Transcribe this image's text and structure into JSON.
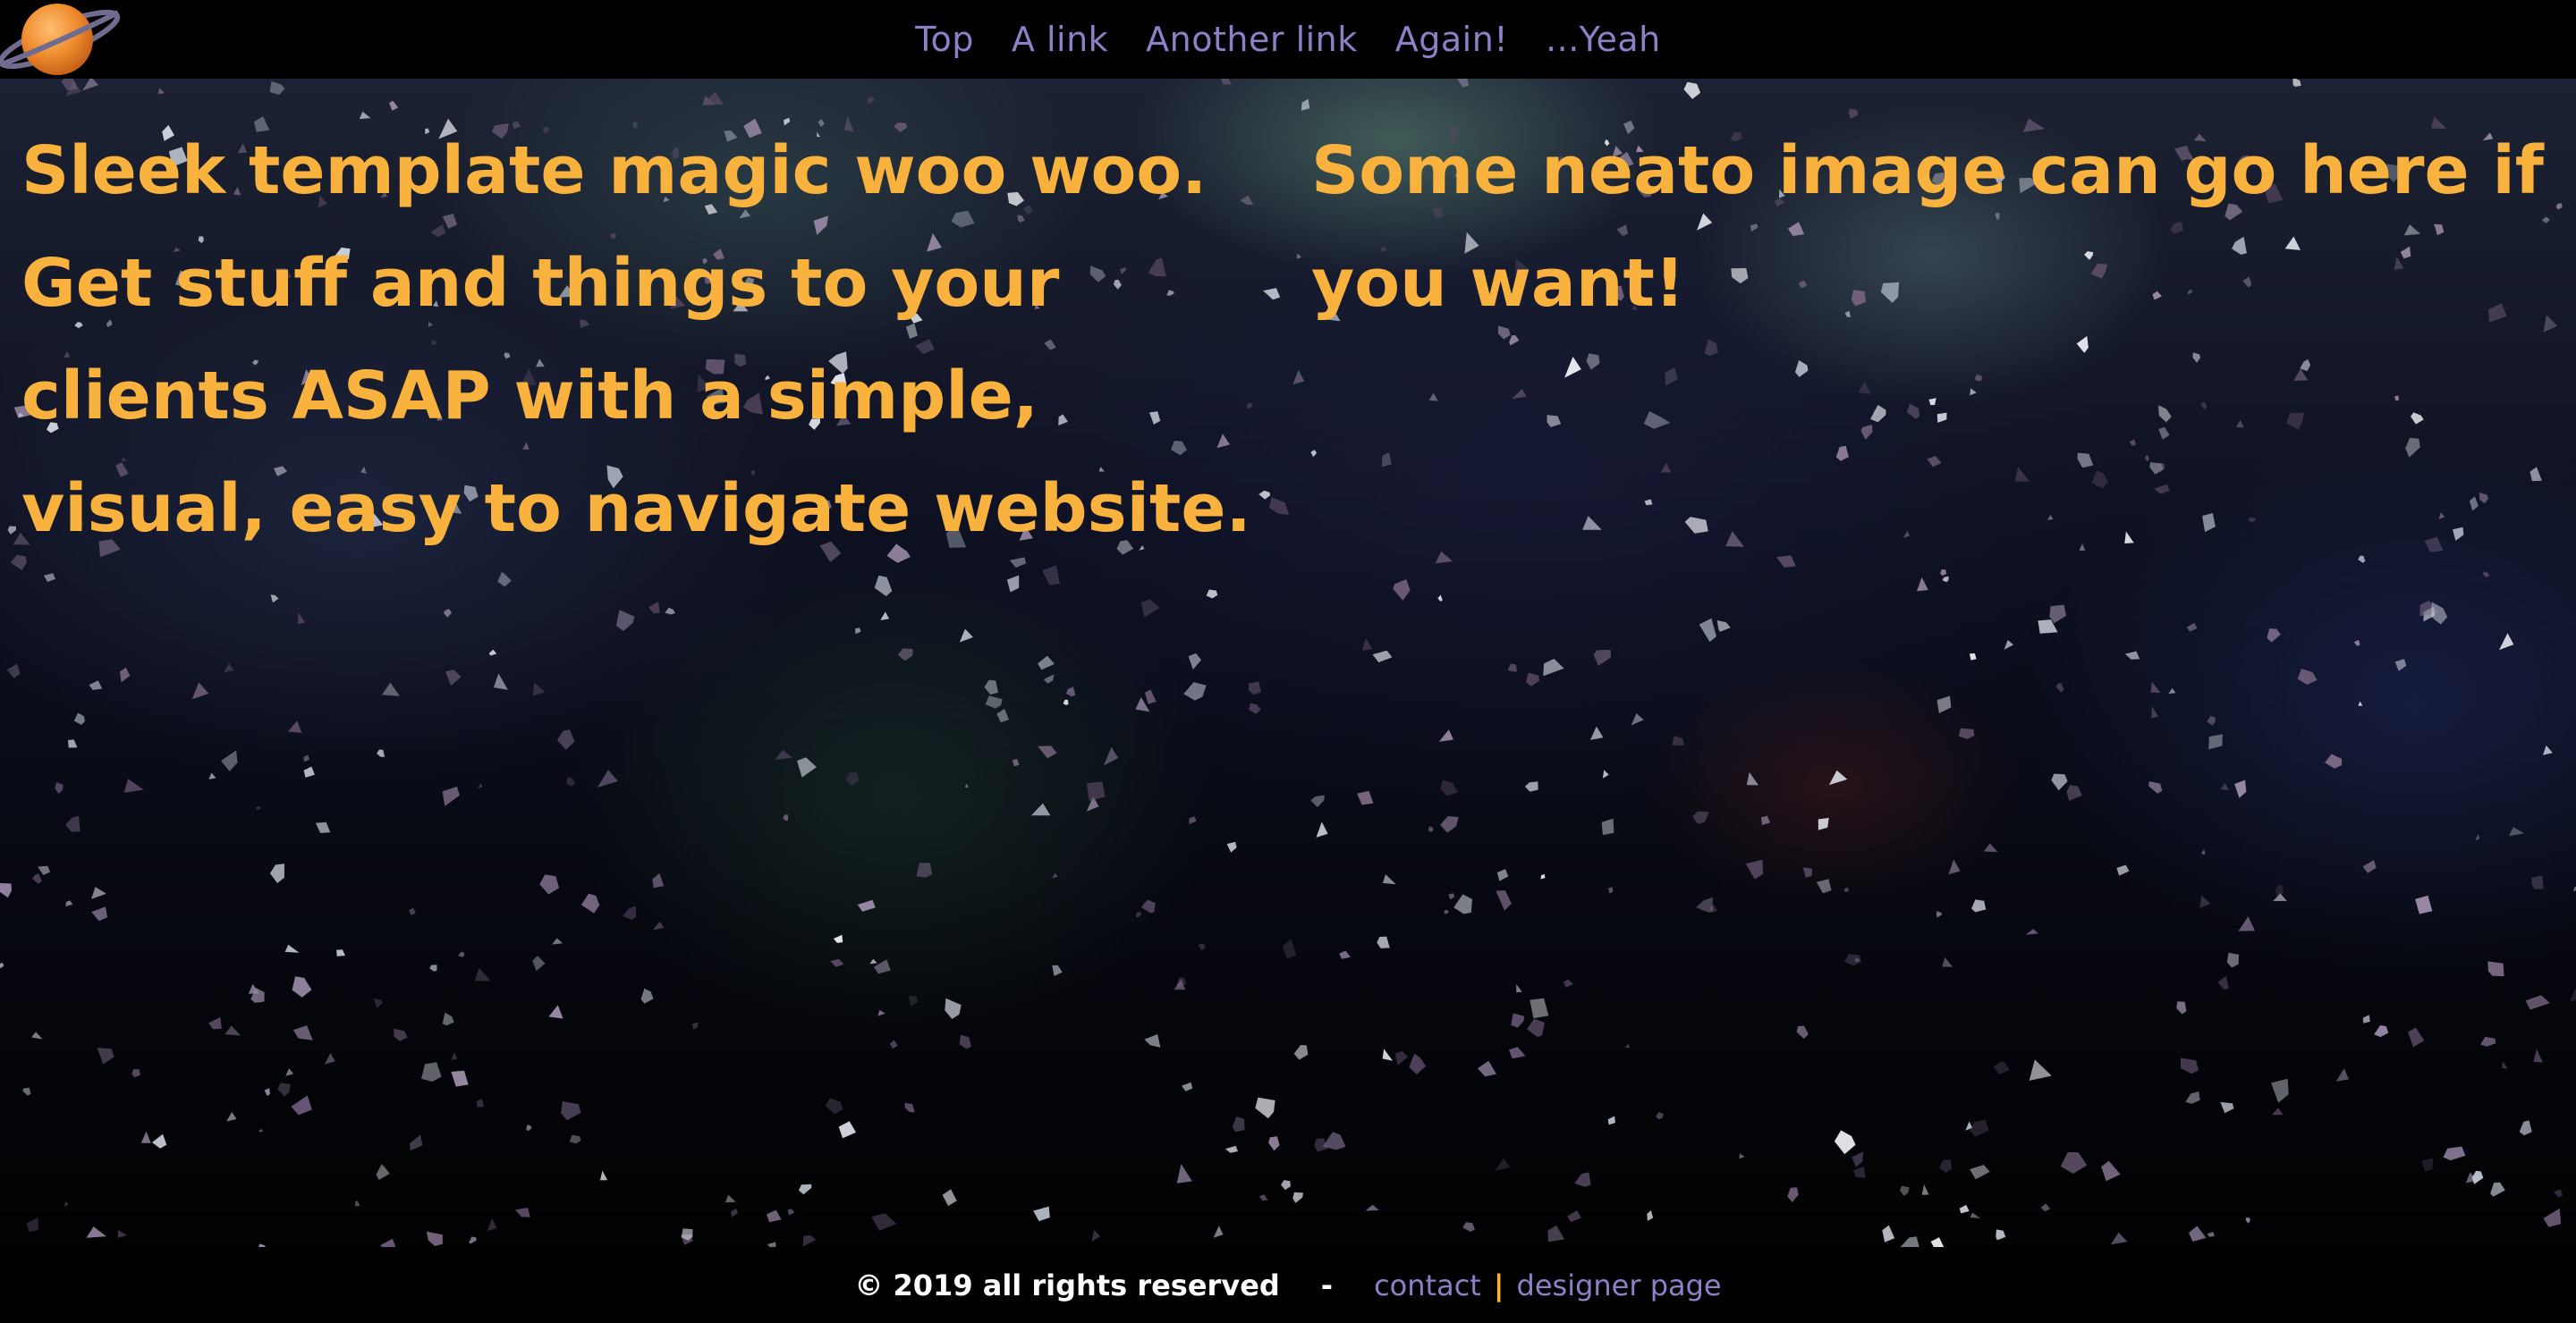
{
  "nav": {
    "items": [
      {
        "label": "Top"
      },
      {
        "label": "A link"
      },
      {
        "label": "Another link"
      },
      {
        "label": "Again!"
      },
      {
        "label": "...Yeah"
      }
    ]
  },
  "main": {
    "hero_text": "Sleek template magic woo woo. Get stuff and things to your clients ASAP with a simple, visual, easy to navigate website.",
    "side_text": "Some neato image can go here if you want!"
  },
  "footer": {
    "copyright": "© 2019 all rights reserved",
    "dash": "-",
    "contact_label": "contact",
    "separator": "|",
    "designer_label": "designer page"
  },
  "colors": {
    "accent_orange": "#f8b23d",
    "link_purple": "#8e7fc6",
    "background": "#000000"
  },
  "icons": {
    "logo": "planet-icon"
  }
}
